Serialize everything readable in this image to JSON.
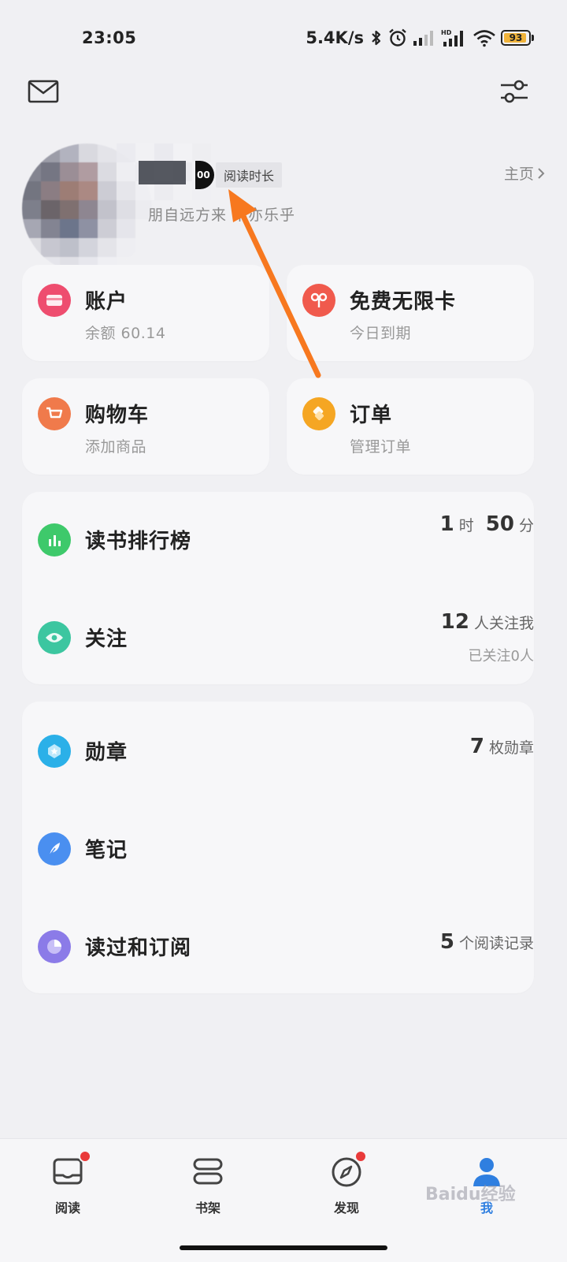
{
  "status_bar": {
    "time": "23:05",
    "net_speed": "5.4K/s",
    "battery": "93",
    "battery_level": 0.93,
    "icons": [
      "bluetooth-icon",
      "alarm-icon",
      "signal-icon",
      "hd-signal-icon",
      "wifi-icon",
      "battery-icon"
    ]
  },
  "header": {
    "mail_icon": "mail-icon",
    "settings_icon": "sliders-icon"
  },
  "profile": {
    "read_badge": "阅读时长",
    "vip_digits": "00",
    "home_link": "主页",
    "signature": "朋自远方来 不亦乐乎"
  },
  "cards": {
    "account": {
      "title": "账户",
      "sub": "余额 60.14",
      "color": "#ee4d6f"
    },
    "free_card": {
      "title": "免费无限卡",
      "sub": "今日到期",
      "color": "#f05a4d"
    },
    "cart": {
      "title": "购物车",
      "sub": "添加商品",
      "color": "#f07a4b"
    },
    "orders": {
      "title": "订单",
      "sub": "管理订单",
      "color": "#f5a623"
    }
  },
  "stats": {
    "ranking": {
      "label": "读书排行榜",
      "hours": "1",
      "hours_unit": "时",
      "minutes": "50",
      "minutes_unit": "分"
    },
    "follow": {
      "label": "关注",
      "count": "12",
      "count_unit": "人关注我",
      "sub": "已关注0人"
    }
  },
  "more": {
    "badges": {
      "label": "勋章",
      "count": "7",
      "unit": "枚勋章"
    },
    "notes": {
      "label": "笔记"
    },
    "history": {
      "label": "读过和订阅",
      "count": "5",
      "unit": "个阅读记录"
    }
  },
  "nav": {
    "items": [
      {
        "label": "阅读",
        "badge": true
      },
      {
        "label": "书架",
        "badge": false
      },
      {
        "label": "发现",
        "badge": true
      },
      {
        "label": "我",
        "badge": false
      }
    ]
  },
  "watermark": "Baidu经验",
  "annotation_color": "#f7781f"
}
